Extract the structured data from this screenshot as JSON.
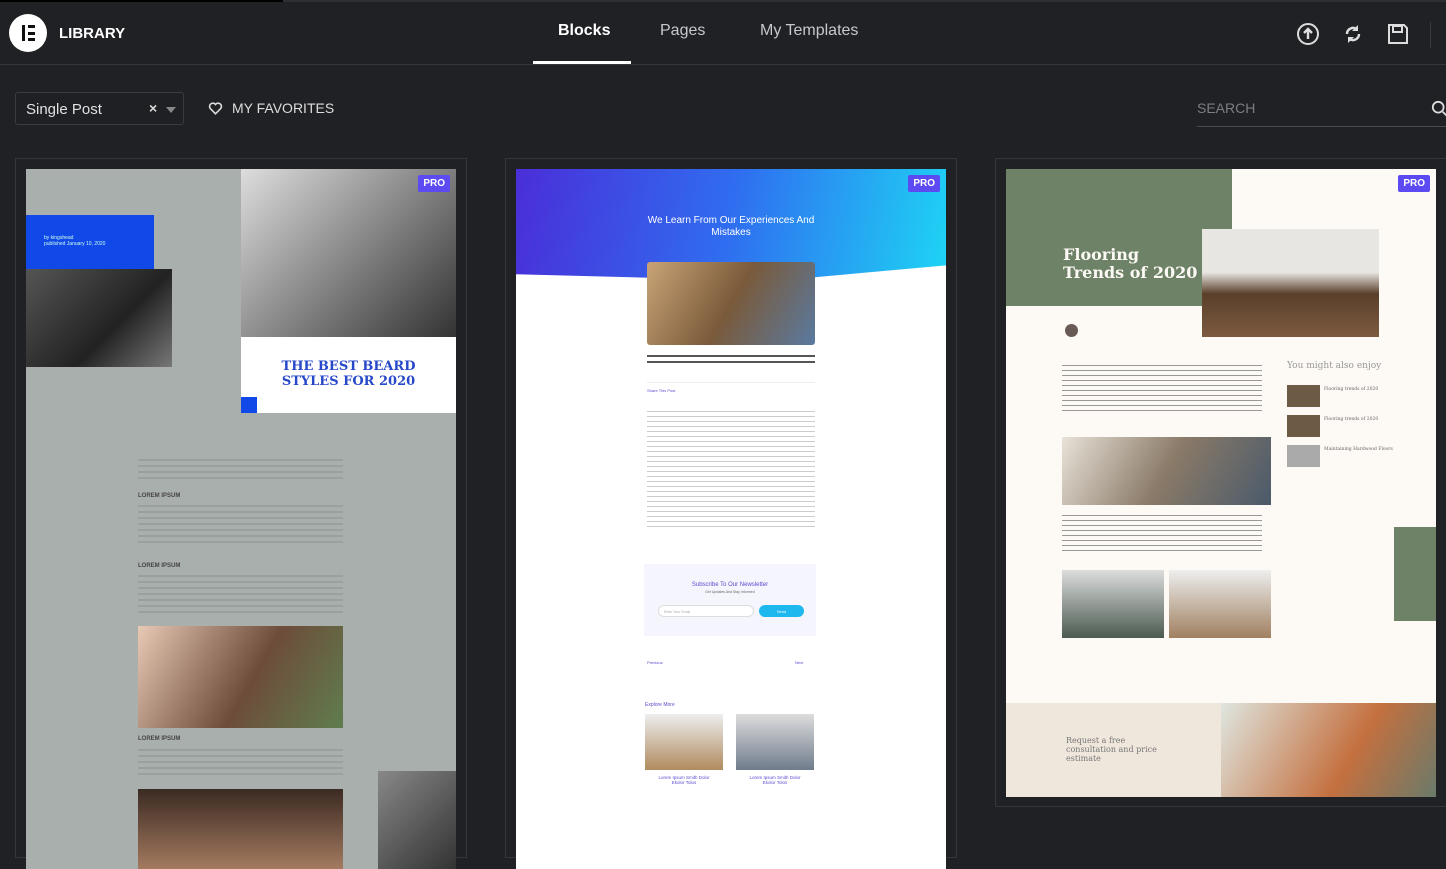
{
  "header": {
    "title": "LIBRARY",
    "tabs": [
      {
        "label": "Blocks",
        "active": true
      },
      {
        "label": "Pages"
      },
      {
        "label": "My Templates"
      }
    ],
    "icons": [
      "upload-icon",
      "sync-icon",
      "save-icon"
    ]
  },
  "filters": {
    "category_value": "Single Post",
    "clear_label": "×",
    "favorites_label": "MY FAVORITES",
    "search_placeholder": "SEARCH"
  },
  "accent": "#5c4bf2",
  "templates": [
    {
      "badge": "PRO",
      "headline": "THE BEST BEARD STYLES FOR 2020",
      "section": "LOREM IPSUM",
      "byline": "by kingshead",
      "date": "published January 10, 2020"
    },
    {
      "badge": "PRO",
      "headline": "We Learn From Our Experiences And Mistakes",
      "share": "Share This Post",
      "newsletter_title": "Subscribe To Our Newsletter",
      "newsletter_sub": "Get Updates And Stay Informed",
      "email_placeholder": "Enter Your Email",
      "send": "Send",
      "previous": "Previous",
      "next": "Next",
      "explore": "Explore More",
      "card_title": "Lorem Ipsum Smith Dolor Ekolor Tolos"
    },
    {
      "badge": "PRO",
      "headline": "Flooring Trends of 2020",
      "sidebar_title": "You might also enjoy",
      "related": [
        "Flooring trends of 2020",
        "Flooring trends of 2020",
        "Maintaining Hardwood Floors"
      ],
      "cta": "Request a free consultation and price estimate"
    }
  ]
}
